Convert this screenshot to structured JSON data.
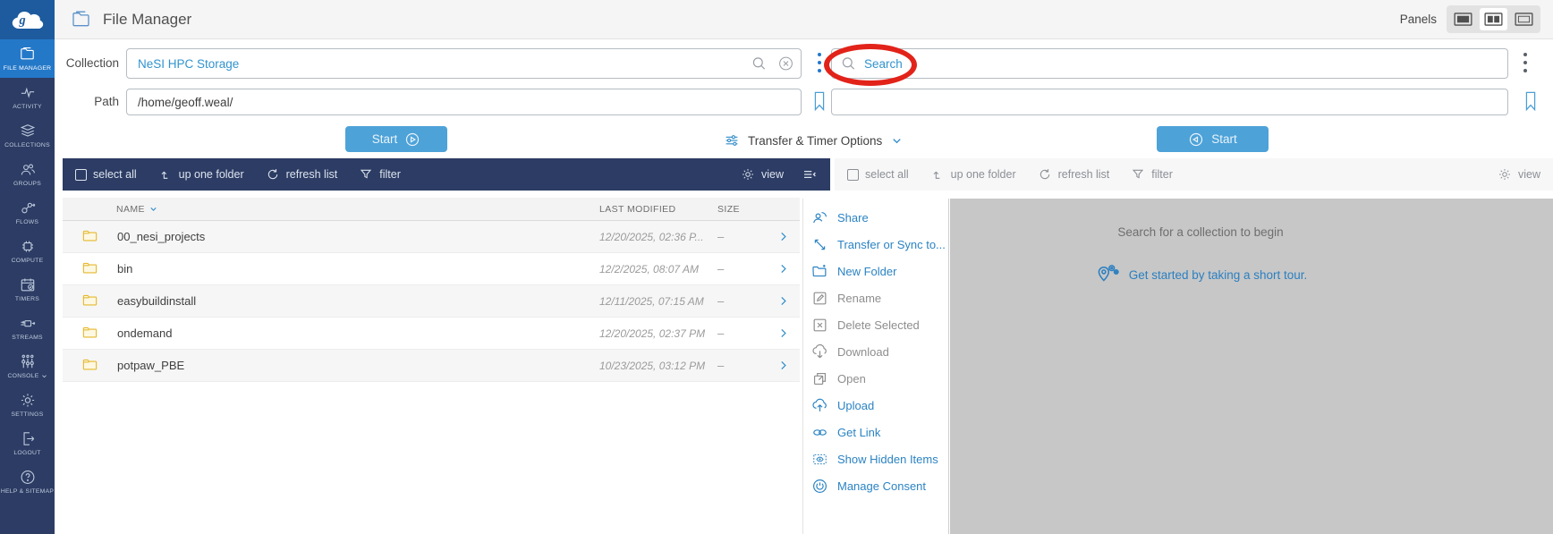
{
  "app": {
    "title": "File Manager",
    "panels_label": "Panels"
  },
  "sidebar": {
    "items": [
      {
        "label": "FILE MANAGER",
        "active": true
      },
      {
        "label": "ACTIVITY"
      },
      {
        "label": "COLLECTIONS"
      },
      {
        "label": "GROUPS"
      },
      {
        "label": "FLOWS"
      },
      {
        "label": "COMPUTE"
      },
      {
        "label": "TIMERS"
      },
      {
        "label": "STREAMS"
      },
      {
        "label": "CONSOLE"
      },
      {
        "label": "SETTINGS"
      },
      {
        "label": "LOGOUT"
      },
      {
        "label": "HELP & SITEMAP"
      }
    ]
  },
  "left": {
    "collection_label": "Collection",
    "collection_value": "NeSI HPC Storage",
    "path_label": "Path",
    "path_value": "/home/geoff.weal/",
    "start_label": "Start",
    "toolbar": {
      "select_all": "select all",
      "up_one_folder": "up one folder",
      "refresh_list": "refresh list",
      "filter": "filter",
      "view": "view"
    },
    "table": {
      "col_name": "NAME",
      "col_modified": "LAST MODIFIED",
      "col_size": "SIZE",
      "rows": [
        {
          "name": "00_nesi_projects",
          "modified": "12/20/2025, 02:36 P...",
          "size": "–"
        },
        {
          "name": "bin",
          "modified": "12/2/2025, 08:07 AM",
          "size": "–"
        },
        {
          "name": "easybuildinstall",
          "modified": "12/11/2025, 07:15 AM",
          "size": "–"
        },
        {
          "name": "ondemand",
          "modified": "12/20/2025, 02:37 PM",
          "size": "–"
        },
        {
          "name": "potpaw_PBE",
          "modified": "10/23/2025, 03:12 PM",
          "size": "–"
        }
      ]
    }
  },
  "center": {
    "transfer_options_label": "Transfer & Timer Options"
  },
  "right": {
    "search_placeholder": "Search",
    "start_label": "Start",
    "toolbar": {
      "select_all": "select all",
      "up_one_folder": "up one folder",
      "refresh_list": "refresh list",
      "filter": "filter",
      "view": "view"
    },
    "empty_title": "Search for a collection to begin",
    "tour_link": "Get started by taking a short tour."
  },
  "action_menu": {
    "items": [
      {
        "label": "Share",
        "style": "accent",
        "icon": "share-icon"
      },
      {
        "label": "Transfer or Sync to...",
        "style": "accent",
        "icon": "transfer-icon"
      },
      {
        "label": "New Folder",
        "style": "accent",
        "icon": "new-folder-icon"
      },
      {
        "label": "Rename",
        "style": "muted",
        "icon": "rename-icon"
      },
      {
        "label": "Delete Selected",
        "style": "muted",
        "icon": "delete-icon"
      },
      {
        "label": "Download",
        "style": "muted",
        "icon": "download-icon"
      },
      {
        "label": "Open",
        "style": "muted",
        "icon": "open-icon"
      },
      {
        "label": "Upload",
        "style": "accent",
        "icon": "upload-icon"
      },
      {
        "label": "Get Link",
        "style": "accent",
        "icon": "link-icon"
      },
      {
        "label": "Show Hidden Items",
        "style": "accent",
        "icon": "eye-icon"
      },
      {
        "label": "Manage Consent",
        "style": "accent",
        "icon": "consent-icon"
      }
    ]
  },
  "colors": {
    "navy": "#2c3c64",
    "active_blue": "#2478c8",
    "logo_blue": "#1d5b9e",
    "accent_blue": "#3193ce",
    "link_blue": "#2b83c3",
    "start_button_blue": "#4da2d8",
    "annotation_red": "#e2231a",
    "folder_yellow": "#e5b92e",
    "panel_gray": "#c7c7c7"
  }
}
